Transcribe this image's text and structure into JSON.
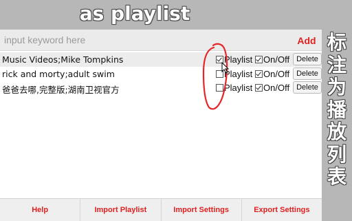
{
  "banner": {
    "title": "as playlist"
  },
  "side_note": {
    "chars": [
      "标",
      "注",
      "为",
      "播",
      "放",
      "列",
      "表"
    ]
  },
  "search": {
    "placeholder": "input keyword here",
    "value": "",
    "add_label": "Add"
  },
  "columns": {
    "playlist_label": "Playlist",
    "onoff_label": "On/Off",
    "delete_label": "Delete"
  },
  "rows": [
    {
      "title": "Music Videos;Mike Tompkins",
      "playlist": true,
      "onoff": true
    },
    {
      "title": "rick and morty;adult swim",
      "playlist": false,
      "onoff": true
    },
    {
      "title": "爸爸去哪,完整版;湖南卫视官方",
      "playlist": false,
      "onoff": true
    }
  ],
  "footer": {
    "help": "Help",
    "import_playlist": "Import Playlist",
    "import_settings": "Import Settings",
    "export_settings": "Export Settings"
  },
  "colors": {
    "accent": "#e01f1f",
    "annotation": "#e5252a"
  },
  "icons": {
    "cursor": "arrow-cursor-icon",
    "annotation": "red-ellipse-annotation"
  }
}
